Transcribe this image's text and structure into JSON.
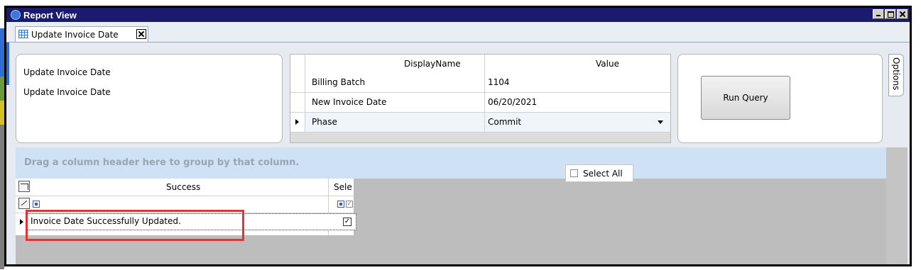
{
  "window": {
    "title": "Report View",
    "controls": [
      "minimize",
      "maximize",
      "close"
    ]
  },
  "tabs": [
    {
      "label": "Update Invoice Date",
      "icon": "grid-icon",
      "closable": true
    }
  ],
  "description": {
    "lines": [
      "Update Invoice Date",
      "Update Invoice Date"
    ]
  },
  "parameters": {
    "headers": {
      "name": "DisplayName",
      "value": "Value"
    },
    "rows": [
      {
        "name": "Billing Batch",
        "value": "1104"
      },
      {
        "name": "New Invoice Date",
        "value": "06/20/2021"
      },
      {
        "name": "Phase",
        "value": "Commit",
        "dropdown": true,
        "selected": true
      }
    ]
  },
  "run_button": {
    "label": "Run Query"
  },
  "options_tab": {
    "label": "Options"
  },
  "group_panel": {
    "hint": "Drag a column header here to group by that column."
  },
  "select_all": {
    "label": "Select All",
    "checked": false
  },
  "results": {
    "headers": {
      "success": "Success",
      "select": "Sele"
    },
    "rows": [
      {
        "success": "Invoice Date Successfully Updated.",
        "selected": true
      }
    ]
  },
  "colors": {
    "title_bar": "#1a1a6e",
    "highlight": "#e53232",
    "group_panel": "#cfe1f5"
  }
}
